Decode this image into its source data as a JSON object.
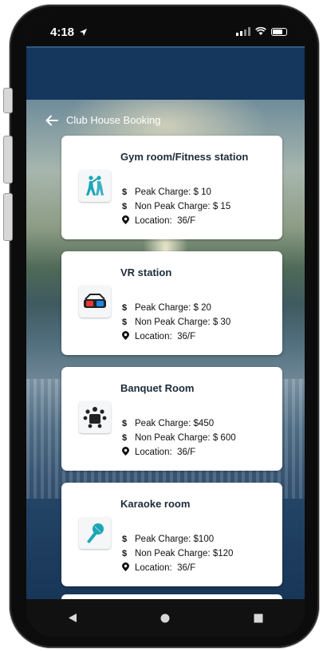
{
  "status_bar": {
    "time": "4:18"
  },
  "page": {
    "title": "Club House Booking"
  },
  "labels": {
    "peak": "Peak Charge:",
    "non_peak": "Non Peak Charge:",
    "location": "Location:"
  },
  "facilities": [
    {
      "name": "Gym room/Fitness station",
      "icon": "fitness-icon",
      "peak_charge": "$ 10",
      "non_peak_charge": "$ 15",
      "location": "36/F"
    },
    {
      "name": "VR station",
      "icon": "vr-headset-icon",
      "peak_charge": "$ 20",
      "non_peak_charge": "$ 30",
      "location": "36/F"
    },
    {
      "name": "Banquet Room",
      "icon": "banquet-icon",
      "peak_charge": "$450",
      "non_peak_charge": "$ 600",
      "location": "36/F"
    },
    {
      "name": "Karaoke room",
      "icon": "microphone-icon",
      "peak_charge": "$100",
      "non_peak_charge": "$120",
      "location": "36/F"
    }
  ],
  "colors": {
    "header": "#15365d",
    "accent_teal": "#1aa6b7",
    "nav_bar": "#111111"
  }
}
